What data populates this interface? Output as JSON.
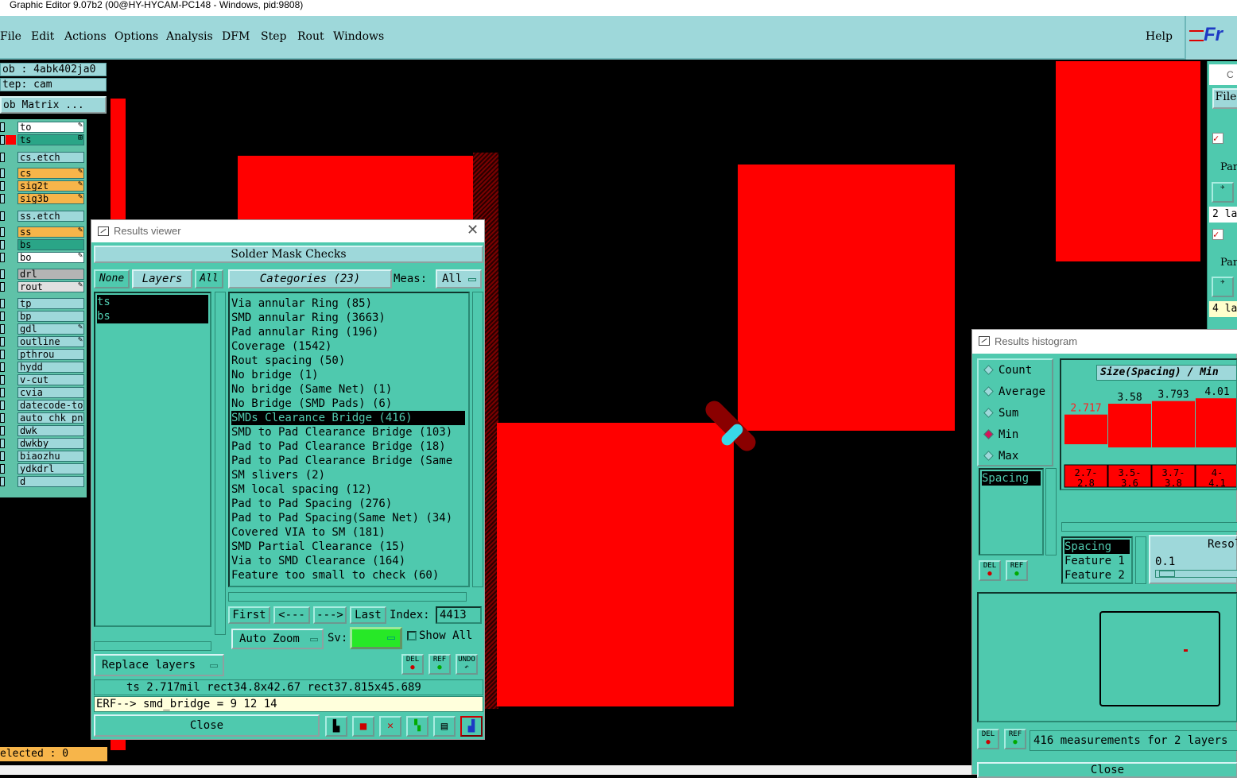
{
  "window_title": "Graphic Editor 9.07b2 (00@HY-HYCAM-PC148 - Windows, pid:9808)",
  "menu": [
    "File",
    "Edit",
    "Actions",
    "Options",
    "Analysis",
    "DFM",
    "Step",
    "Rout",
    "Windows"
  ],
  "help": "Help",
  "logo": "Fr",
  "info": {
    "job": "ob : 4abk402ja0",
    "step": "tep: cam",
    "matrix": "ob Matrix ..."
  },
  "layers": [
    {
      "name": "to",
      "color": "#ffffff",
      "mark": "pen"
    },
    {
      "name": "ts",
      "color": "#2aa587",
      "mark": "grid"
    },
    {
      "name": "cs.etch",
      "color": "#9ed8da",
      "mark": ""
    },
    {
      "name": "cs",
      "color": "#f7b54a",
      "mark": "pen"
    },
    {
      "name": "sig2t",
      "color": "#f7b54a",
      "mark": "pen"
    },
    {
      "name": "sig3b",
      "color": "#f7b54a",
      "mark": "pen"
    },
    {
      "name": "ss.etch",
      "color": "#9ed8da",
      "mark": ""
    },
    {
      "name": "ss",
      "color": "#f7b54a",
      "mark": "pen"
    },
    {
      "name": "bs",
      "color": "#2aa587",
      "mark": ""
    },
    {
      "name": "bo",
      "color": "#ffffff",
      "mark": "pen"
    },
    {
      "name": "drl",
      "color": "#b4b4b4",
      "mark": ""
    },
    {
      "name": "rout",
      "color": "#e0e0e0",
      "mark": "pen"
    },
    {
      "name": "tp",
      "color": "#9ed8da",
      "mark": ""
    },
    {
      "name": "bp",
      "color": "#9ed8da",
      "mark": ""
    },
    {
      "name": "gdl",
      "color": "#9ed8da",
      "mark": "pen"
    },
    {
      "name": "outline",
      "color": "#9ed8da",
      "mark": "pen"
    },
    {
      "name": "pthrou",
      "color": "#9ed8da",
      "mark": ""
    },
    {
      "name": "hydd",
      "color": "#9ed8da",
      "mark": ""
    },
    {
      "name": "v-cut",
      "color": "#9ed8da",
      "mark": ""
    },
    {
      "name": "cvia",
      "color": "#9ed8da",
      "mark": ""
    },
    {
      "name": "datecode-to",
      "color": "#9ed8da",
      "mark": ""
    },
    {
      "name": "auto_chk_pn",
      "color": "#9ed8da",
      "mark": ""
    },
    {
      "name": "dwk",
      "color": "#9ed8da",
      "mark": ""
    },
    {
      "name": "dwkby",
      "color": "#9ed8da",
      "mark": ""
    },
    {
      "name": "biaozhu",
      "color": "#9ed8da",
      "mark": ""
    },
    {
      "name": "ydkdrl",
      "color": "#9ed8da",
      "mark": ""
    },
    {
      "name": "d",
      "color": "#9ed8da",
      "mark": ""
    }
  ],
  "selected_label": "elected : 0",
  "results_viewer": {
    "title": "Results viewer",
    "header": "Solder Mask Checks",
    "none_btn": "None",
    "layers_label": "Layers",
    "all_btn": "All",
    "categories_label": "Categories (23)",
    "meas_label": "Meas:",
    "meas_value": "All",
    "layer_items": [
      "ts",
      "bs"
    ],
    "categories": [
      "Via annular Ring (85)",
      "SMD annular Ring (3663)",
      "Pad annular Ring (196)",
      "Coverage (1542)",
      "Rout spacing (50)",
      "No bridge (1)",
      "No bridge (Same Net) (1)",
      "No Bridge (SMD Pads) (6)",
      "SMDs Clearance Bridge (416)",
      "SMD to Pad Clearance Bridge (103)",
      "Pad to Pad Clearance Bridge (18)",
      "Pad to Pad Clearance Bridge (Same",
      "SM slivers (2)",
      "SM local spacing (12)",
      "Pad to Pad Spacing (276)",
      "Pad to Pad Spacing(Same Net) (34)",
      "Covered VIA to SM (181)",
      "SMD Partial Clearance (15)",
      "Via to SMD Clearance (164)",
      "Feature too small to check (60)"
    ],
    "selected_category": 8,
    "nav": {
      "first": "First",
      "prev": "<---",
      "next": "--->",
      "last": "Last",
      "index_label": "Index:",
      "index_value": "4413"
    },
    "auto_zoom": "Auto Zoom",
    "sv_label": "Sv:",
    "show_all": "Show All",
    "replace_layers": "Replace layers",
    "del": "DEL",
    "ref": "REF",
    "undo": "UNDO",
    "status_line": "ts 2.717mil  rect34.8x42.67  rect37.815x45.689",
    "erf_line": "ERF--> smd_bridge = 9 12 14",
    "close": "Close"
  },
  "histogram": {
    "title": "Results histogram",
    "modes": [
      "Count",
      "Average",
      "Sum",
      "Min",
      "Max"
    ],
    "selected_mode": "Min",
    "axis_label": "Size(Spacing) / Min",
    "field_list": [
      "Spacing"
    ],
    "bars": [
      {
        "label": "2.7-\n2.8",
        "value": 2.717,
        "highlight": true
      },
      {
        "label": "3.5-\n3.6",
        "value": 3.58,
        "highlight": false
      },
      {
        "label": "3.7-\n3.8",
        "value": 3.793,
        "highlight": false
      },
      {
        "label": "4-\n4.1",
        "value": 4.01,
        "highlight": false
      }
    ],
    "bar_value_labels": [
      "2.717",
      "3.58",
      "3.793",
      "4.01"
    ],
    "bin_labels": [
      "2.7-2.8",
      "3.5-3.6",
      "3.7-3.8",
      "4-4.1"
    ],
    "sort_list": [
      "Spacing",
      "Feature 1",
      "Feature 2"
    ],
    "resol_label": "Resol",
    "resol_value": "0.1",
    "measurements": "416 measurements for 2 layers",
    "close": "Close",
    "del": "DEL",
    "ref": "REF"
  },
  "right_panel": {
    "file": "File",
    "par": "Par",
    "two_layers": "2 la",
    "four_layers": "4 la",
    "window_title_fragment": "C"
  },
  "colors": {
    "teal": "#4fc9ae",
    "lightteal": "#9ed8da",
    "pad_red": "#ff0000",
    "highlight_red": "#d4145a",
    "sv_green": "#27e827"
  }
}
